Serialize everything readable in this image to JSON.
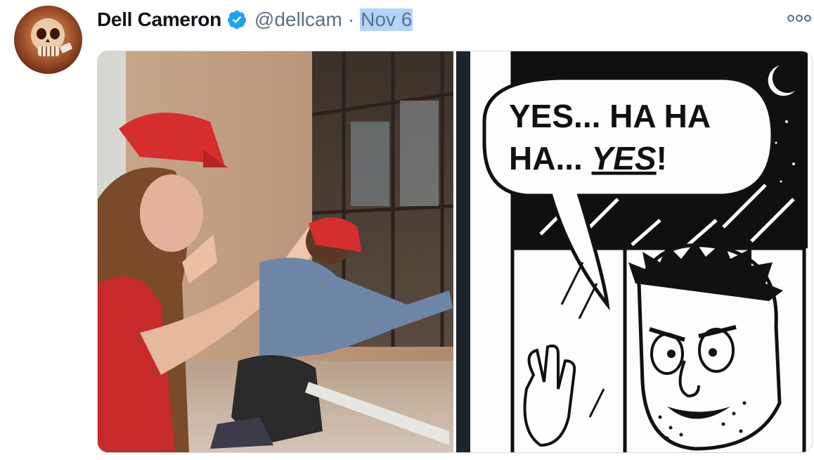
{
  "tweet": {
    "author_name": "Dell Cameron",
    "author_handle": "@dellcam",
    "separator": "·",
    "date": "Nov 6"
  },
  "icons": {
    "verified": "verified-badge-icon",
    "more": "more-options-icon"
  },
  "colors": {
    "verified_blue": "#1da1f2",
    "handle_gray": "#5b7083",
    "selection_highlight": "#b3d4fc"
  },
  "media": {
    "comic": {
      "speech_line1": "YES... HA HA",
      "speech_line2_prefix": "HA...",
      "speech_line2_emph": "YES",
      "speech_line2_suffix": "!"
    }
  }
}
